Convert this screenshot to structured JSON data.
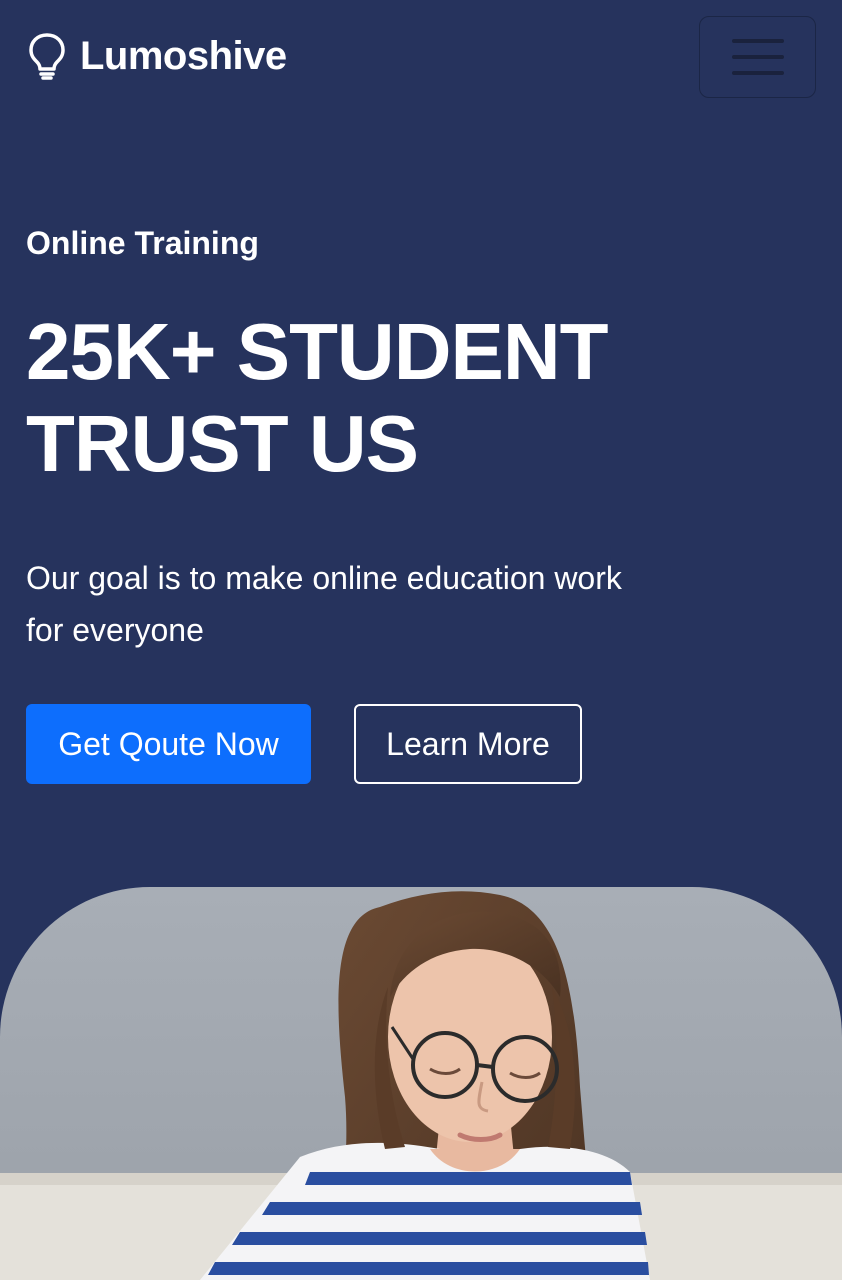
{
  "brand": {
    "name": "Lumoshive",
    "icon": "lightbulb-icon"
  },
  "navbar": {
    "toggle_icon": "hamburger-menu-icon"
  },
  "hero": {
    "eyebrow": "Online Training",
    "headline": "25K+ STUDENT TRUST US",
    "tagline": "Our goal is to make online education work for everyone",
    "primary_button": "Get Qoute Now",
    "secondary_button": "Learn More"
  },
  "colors": {
    "background": "#26335d",
    "primary": "#0d6efd",
    "text": "#ffffff"
  }
}
